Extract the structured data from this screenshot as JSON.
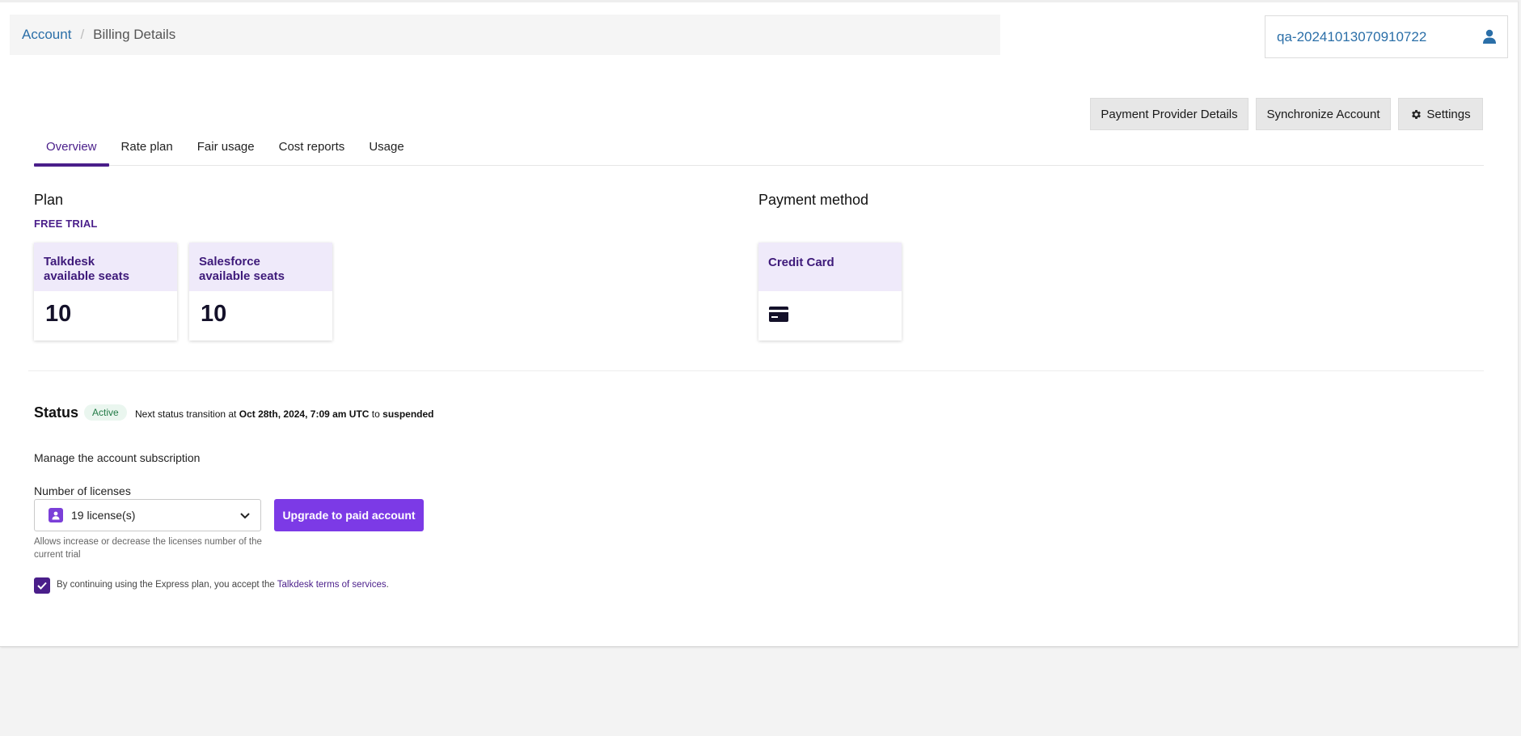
{
  "breadcrumb": {
    "root": "Account",
    "separator": "/",
    "current": "Billing Details"
  },
  "account": {
    "id": "qa-20241013070910722",
    "icon": "user-icon"
  },
  "actions": {
    "provider_label": "Payment Provider Details",
    "sync_label": "Synchronize Account",
    "settings_label": "Settings"
  },
  "tabs": [
    {
      "label": "Overview",
      "active": true
    },
    {
      "label": "Rate plan",
      "active": false
    },
    {
      "label": "Fair usage",
      "active": false
    },
    {
      "label": "Cost reports",
      "active": false
    },
    {
      "label": "Usage",
      "active": false
    }
  ],
  "plan": {
    "title": "Plan",
    "tag": "FREE TRIAL",
    "cards": [
      {
        "line1": "Talkdesk",
        "line2": "available seats",
        "value": "10"
      },
      {
        "line1": "Salesforce",
        "line2": "available seats",
        "value": "10"
      }
    ]
  },
  "payment": {
    "title": "Payment method",
    "card_label": "Credit Card",
    "icon": "credit-card-icon"
  },
  "status": {
    "title": "Status",
    "badge": "Active",
    "prefix": "Next status transition at ",
    "date": "Oct 28th, 2024, 7:09 am UTC",
    "middle": " to ",
    "target": "suspended"
  },
  "subscription": {
    "manage_text": "Manage the account subscription",
    "licenses_label": "Number of licenses",
    "licenses_value": "19 license(s)",
    "upgrade_label": "Upgrade to paid account",
    "hint": "Allows increase or decrease the licenses number of the current trial",
    "terms_prefix": "By continuing using the Express plan, you accept the ",
    "terms_link": "Talkdesk terms of services",
    "terms_suffix": "."
  },
  "colors": {
    "accent": "#4a1e8a",
    "button_purple": "#7c3ae6",
    "link_blue": "#2b6fa8",
    "status_green": "#217a45"
  }
}
